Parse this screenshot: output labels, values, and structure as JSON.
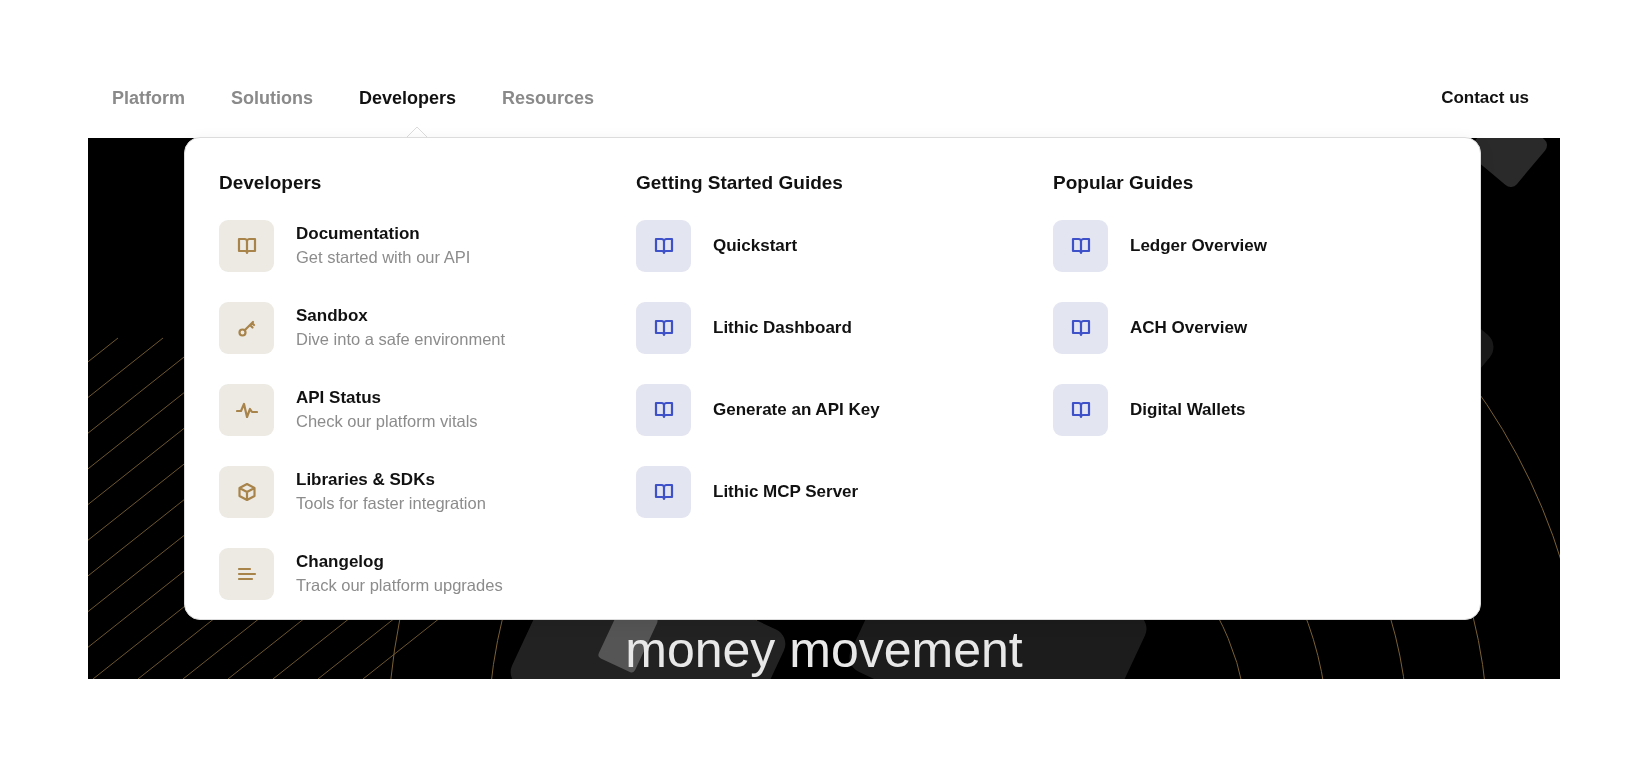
{
  "nav": {
    "items": [
      {
        "label": "Platform",
        "selected": false
      },
      {
        "label": "Solutions",
        "selected": false
      },
      {
        "label": "Developers",
        "selected": true
      },
      {
        "label": "Resources",
        "selected": false
      }
    ],
    "contact": "Contact us"
  },
  "dropdown": {
    "columns": [
      {
        "title": "Developers",
        "color": "#a8844a",
        "items": [
          {
            "title": "Documentation",
            "description": "Get started with our API"
          },
          {
            "title": "Sandbox",
            "description": "Dive into a safe environment"
          },
          {
            "title": "API Status",
            "description": "Check our platform vitals"
          },
          {
            "title": "Libraries & SDKs",
            "description": "Tools for faster integration"
          },
          {
            "title": "Changelog",
            "description": "Track our platform upgrades"
          }
        ]
      },
      {
        "title": "Getting Started Guides",
        "color": "#3f51c8",
        "items": [
          {
            "title": "Quickstart"
          },
          {
            "title": "Lithic Dashboard"
          },
          {
            "title": "Generate an API Key"
          },
          {
            "title": "Lithic MCP Server"
          }
        ]
      },
      {
        "title": "Popular Guides",
        "color": "#3f51c8",
        "items": [
          {
            "title": "Ledger Overview"
          },
          {
            "title": "ACH Overview"
          },
          {
            "title": "Digital Wallets"
          }
        ]
      }
    ]
  },
  "hero": {
    "heading": "money movement"
  }
}
